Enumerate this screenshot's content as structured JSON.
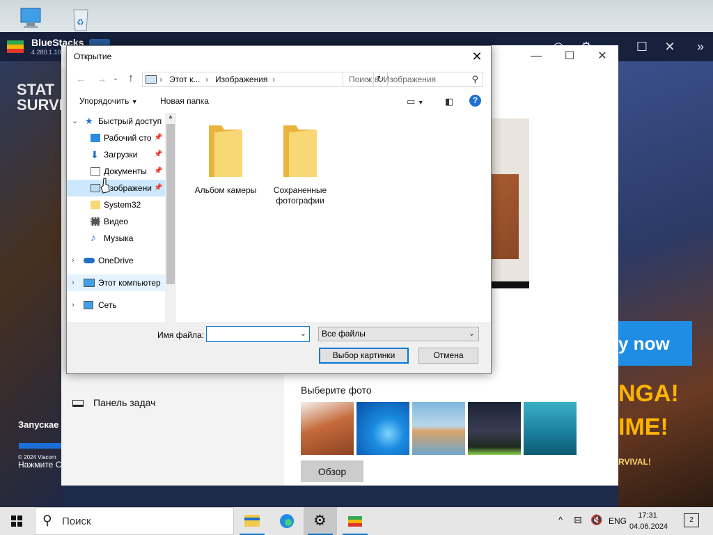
{
  "bluestacks": {
    "name": "BlueStacks",
    "version": "4.280.1.10",
    "game_title_line1": "STAT",
    "game_title_line2": "SURVIV",
    "loading_text": "Запускае",
    "copyright": "© 2024 Viacom",
    "press_text": "Нажмите С",
    "play_now": "y now",
    "ad_text1": "NGA!",
    "ad_text2": "IME!",
    "ad_text3": "RVIVAL!"
  },
  "settings": {
    "taskbar_label": "Панель задач",
    "choose_photo_label": "Выберите фото",
    "browse_button": "Обзор"
  },
  "dialog": {
    "title": "Открытие",
    "address": {
      "segment1": "Этот к...",
      "segment2": "Изображения"
    },
    "search_placeholder": "Поиск в: Изображения",
    "toolbar": {
      "organize": "Упорядочить",
      "new_folder": "Новая папка"
    },
    "tree": [
      {
        "label": "Быстрый доступ"
      },
      {
        "label": "Рабочий сто"
      },
      {
        "label": "Загрузки"
      },
      {
        "label": "Документы"
      },
      {
        "label": "Изображени"
      },
      {
        "label": "System32"
      },
      {
        "label": "Видео"
      },
      {
        "label": "Музыка"
      },
      {
        "label": "OneDrive"
      },
      {
        "label": "Этот компьютер"
      },
      {
        "label": "Сеть"
      }
    ],
    "folders": [
      {
        "label": "Альбом камеры"
      },
      {
        "label": "Сохраненные фотографии"
      }
    ],
    "filename_label": "Имя файла:",
    "filename_value": "",
    "filter_value": "Все файлы",
    "ok_button": "Выбор картинки",
    "cancel_button": "Отмена"
  },
  "taskbar": {
    "search_text": "Поиск",
    "lang": "ENG",
    "time": "17:31",
    "date": "04.06.2024",
    "notifications": "2"
  },
  "colors": {
    "accent": "#0078d7",
    "selection": "#cce8ff",
    "folder": "#f8d775",
    "play_now": "#1f8de3"
  }
}
